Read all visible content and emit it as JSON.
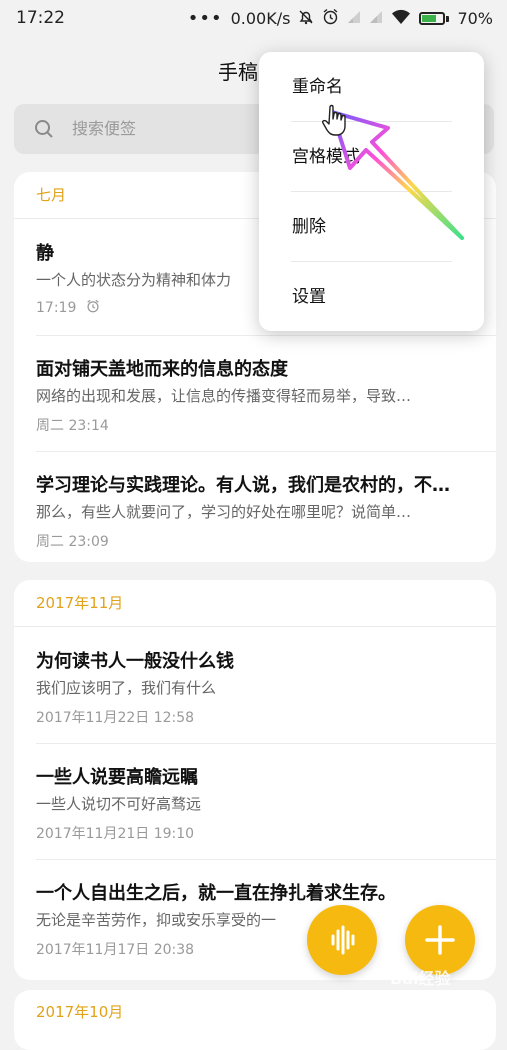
{
  "status_bar": {
    "time": "17:22",
    "dots": "•••",
    "network_speed": "0.00K/s",
    "battery": "70%",
    "battery_level": 0.7,
    "icons": [
      "silent-bell-icon",
      "alarm-icon",
      "signal-icon",
      "signal-icon",
      "wifi-icon",
      "battery-charging-icon"
    ]
  },
  "header": {
    "title": "手稿"
  },
  "search": {
    "placeholder": "搜索便签"
  },
  "groups": [
    {
      "header": "七月",
      "notes": [
        {
          "title": "静",
          "body": "一个人的状态分为精神和体力",
          "time": "17:19",
          "has_alarm": true
        },
        {
          "title": "面对铺天盖地而来的信息的态度",
          "body": "网络的出现和发展，让信息的传播变得轻而易举，导致…",
          "time": "周二 23:14"
        },
        {
          "title": "学习理论与实践理论。有人说，我们是农村的，不…",
          "body": "那么，有些人就要问了，学习的好处在哪里呢？说简单…",
          "time": "周二 23:09"
        }
      ]
    },
    {
      "header": "2017年11月",
      "notes": [
        {
          "title": "为何读书人一般没什么钱",
          "body": "我们应该明了，我们有什么",
          "time": "2017年11月22日 12:58"
        },
        {
          "title": "一些人说要高瞻远瞩",
          "body": "一些人说切不可好高骛远",
          "time": "2017年11月21日 19:10"
        },
        {
          "title": "一个人自出生之后，就一直在挣扎着求生存。",
          "body": "无论是辛苦劳作，抑或安乐享受的一",
          "time": "2017年11月17日 20:38"
        }
      ]
    },
    {
      "header": "2017年10月"
    }
  ],
  "menu": {
    "items": [
      {
        "label": "重命名"
      },
      {
        "label": "宫格模式"
      },
      {
        "label": "删除"
      },
      {
        "label": "设置"
      }
    ]
  },
  "fabs": {
    "voice_icon": "voice-wave-icon",
    "add_icon": "plus-icon"
  },
  "watermark": "Bai经验",
  "colors": {
    "accent": "#f5b90f",
    "group_header": "#e2a21a",
    "background": "#f2f2f2"
  }
}
